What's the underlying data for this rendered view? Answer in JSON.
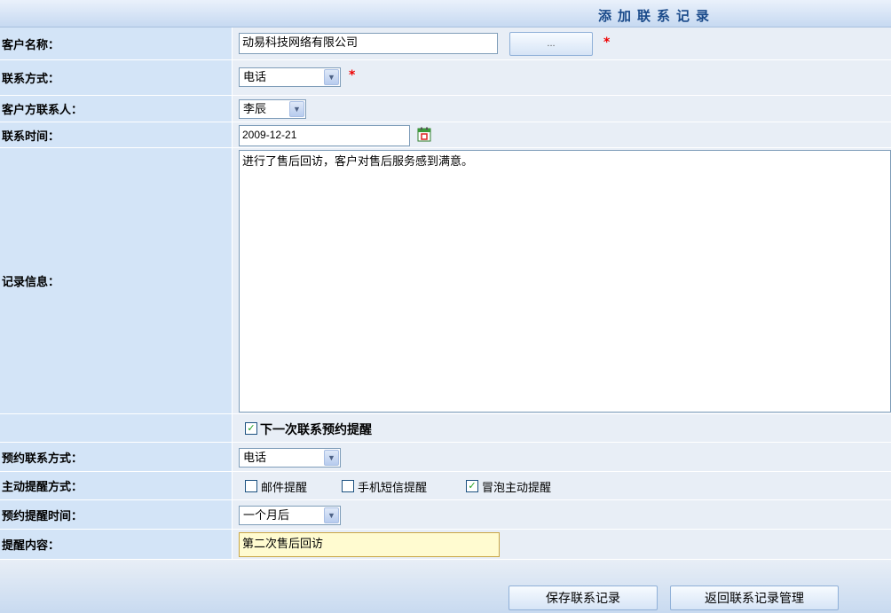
{
  "header": {
    "title": "添加联系记录"
  },
  "form": {
    "customer": {
      "label": "客户名称：",
      "value": "动易科技网络有限公司",
      "picker_label": "...",
      "required": "*"
    },
    "contact_method": {
      "label": "联系方式：",
      "value": "电话",
      "required": "*"
    },
    "contact_person": {
      "label": "客户方联系人：",
      "value": "李辰"
    },
    "contact_time": {
      "label": "联系时间：",
      "value": "2009-12-21"
    },
    "record_info": {
      "label": "记录信息：",
      "value": "进行了售后回访，客户对售后服务感到满意。"
    },
    "next_reminder": {
      "label": "下一次联系预约提醒",
      "checked": true
    },
    "scheduled_method": {
      "label": "预约联系方式：",
      "value": "电话"
    },
    "reminder_modes": {
      "label": "主动提醒方式：",
      "options": [
        {
          "label": "邮件提醒",
          "checked": false
        },
        {
          "label": "手机短信提醒",
          "checked": false
        },
        {
          "label": "冒泡主动提醒",
          "checked": true
        }
      ]
    },
    "reminder_time": {
      "label": "预约提醒时间：",
      "value": "一个月后"
    },
    "reminder_content": {
      "label": "提醒内容：",
      "value": "第二次售后回访"
    }
  },
  "actions": {
    "save_label": "保存联系记录",
    "back_label": "返回联系记录管理"
  },
  "icons": {
    "calendar": "calendar-icon",
    "dropdown": "chevron-down-icon",
    "check": "check-icon"
  },
  "colors": {
    "accent": "#1a4a8a",
    "label_bg": "#d3e4f7",
    "required": "#e00000",
    "highlight_input": "#fffbd0"
  }
}
